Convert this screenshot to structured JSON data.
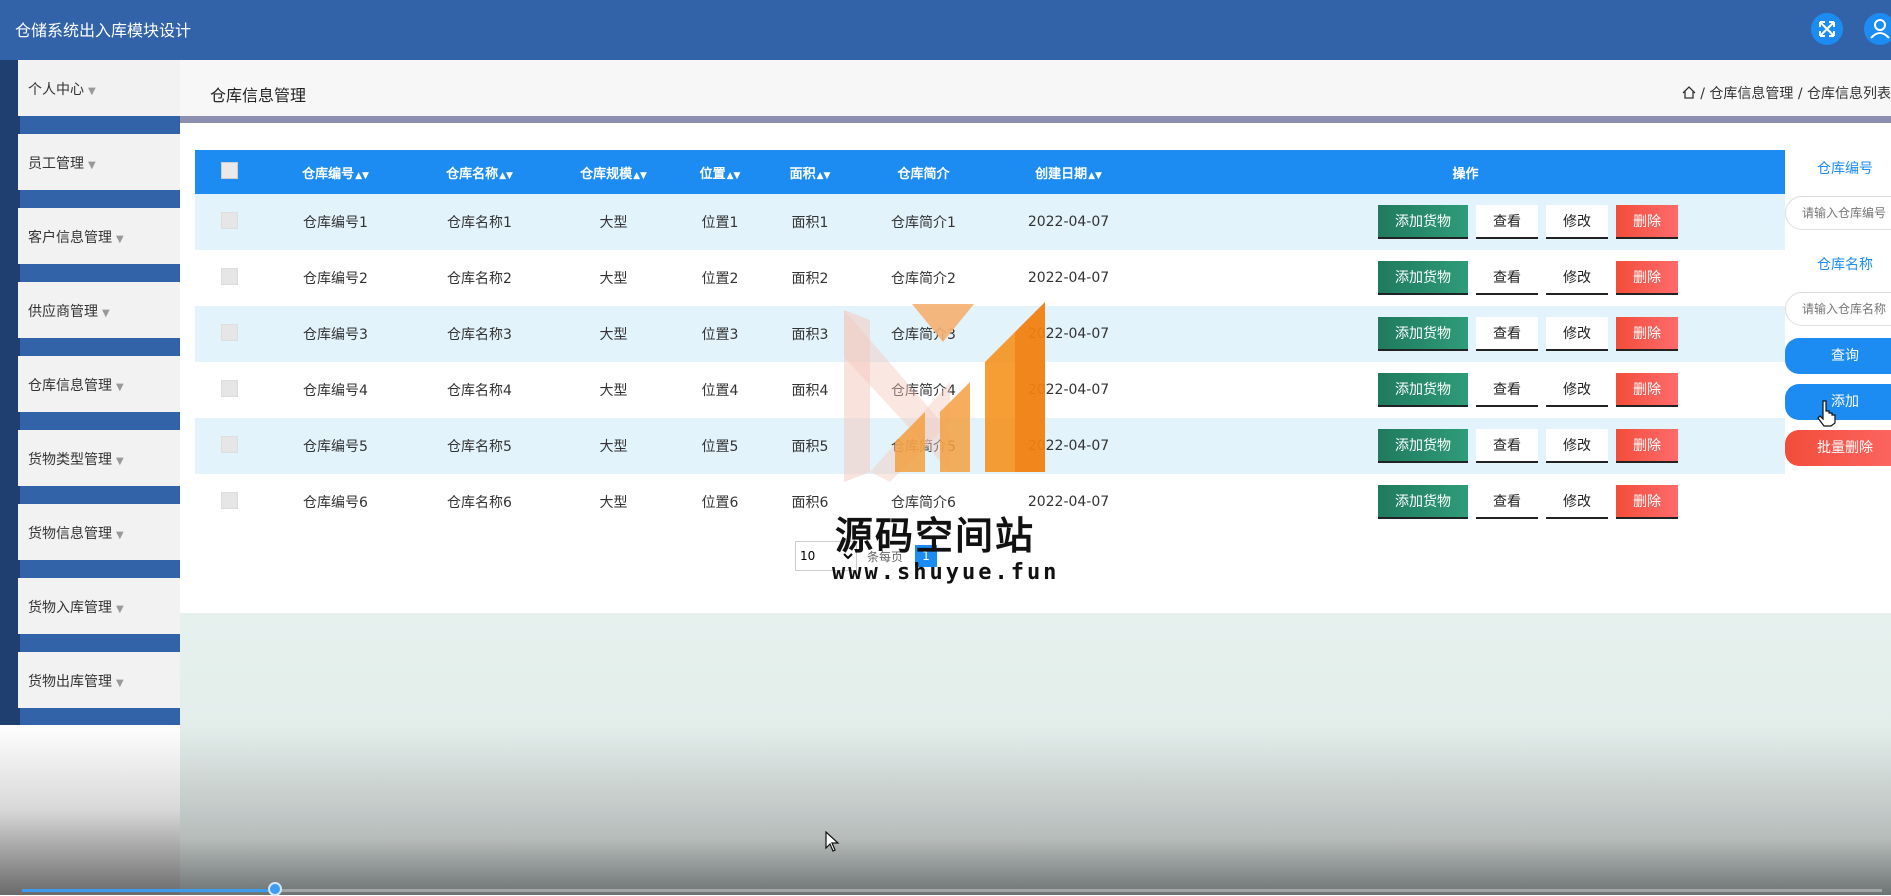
{
  "app": {
    "title": "仓储系统出入库模块设计"
  },
  "topbar": {
    "fullscreen_icon": "expand-icon",
    "user_icon": "user-icon"
  },
  "sidebar": {
    "items": [
      {
        "label": "个人中心"
      },
      {
        "label": "员工管理"
      },
      {
        "label": "客户信息管理"
      },
      {
        "label": "供应商管理"
      },
      {
        "label": "仓库信息管理"
      },
      {
        "label": "货物类型管理"
      },
      {
        "label": "货物信息管理"
      },
      {
        "label": "货物入库管理"
      },
      {
        "label": "货物出库管理"
      }
    ]
  },
  "header": {
    "title": "仓库信息管理",
    "breadcrumb": [
      "仓库信息管理",
      "仓库信息列表"
    ],
    "separator": "/"
  },
  "table": {
    "columns": [
      "仓库编号",
      "仓库名称",
      "仓库规模",
      "位置",
      "面积",
      "仓库简介",
      "创建日期",
      "操作"
    ],
    "sortable": [
      true,
      true,
      true,
      true,
      true,
      false,
      true,
      false
    ],
    "rows": [
      {
        "code": "仓库编号1",
        "name": "仓库名称1",
        "scale": "大型",
        "location": "位置1",
        "area": "面积1",
        "intro": "仓库简介1",
        "date": "2022-04-07"
      },
      {
        "code": "仓库编号2",
        "name": "仓库名称2",
        "scale": "大型",
        "location": "位置2",
        "area": "面积2",
        "intro": "仓库简介2",
        "date": "2022-04-07"
      },
      {
        "code": "仓库编号3",
        "name": "仓库名称3",
        "scale": "大型",
        "location": "位置3",
        "area": "面积3",
        "intro": "仓库简介3",
        "date": "2022-04-07"
      },
      {
        "code": "仓库编号4",
        "name": "仓库名称4",
        "scale": "大型",
        "location": "位置4",
        "area": "面积4",
        "intro": "仓库简介4",
        "date": "2022-04-07"
      },
      {
        "code": "仓库编号5",
        "name": "仓库名称5",
        "scale": "大型",
        "location": "位置5",
        "area": "面积5",
        "intro": "仓库简介5",
        "date": "2022-04-07"
      },
      {
        "code": "仓库编号6",
        "name": "仓库名称6",
        "scale": "大型",
        "location": "位置6",
        "area": "面积6",
        "intro": "仓库简介6",
        "date": "2022-04-07"
      }
    ],
    "actions": {
      "add_goods": "添加货物",
      "view": "查看",
      "edit": "修改",
      "delete": "删除"
    }
  },
  "pagination": {
    "page_size": "10",
    "per_page_label": "条每页",
    "current_page": "1"
  },
  "search": {
    "code_label": "仓库编号",
    "code_placeholder": "请输入仓库编号",
    "name_label": "仓库名称",
    "name_placeholder": "请输入仓库名称",
    "query_button": "查询",
    "add_button": "添加",
    "batch_delete_button": "批量删除"
  },
  "watermark": {
    "text": "源码空间站",
    "url": "www.shuyue.fun"
  },
  "colors": {
    "topbar": "#3263a8",
    "table_header": "#1d8cf2",
    "row_alt": "#e2f3fb",
    "add_goods": "#2f9c78",
    "delete": "#f24d3a",
    "watermark_orange": "#f5921e"
  }
}
